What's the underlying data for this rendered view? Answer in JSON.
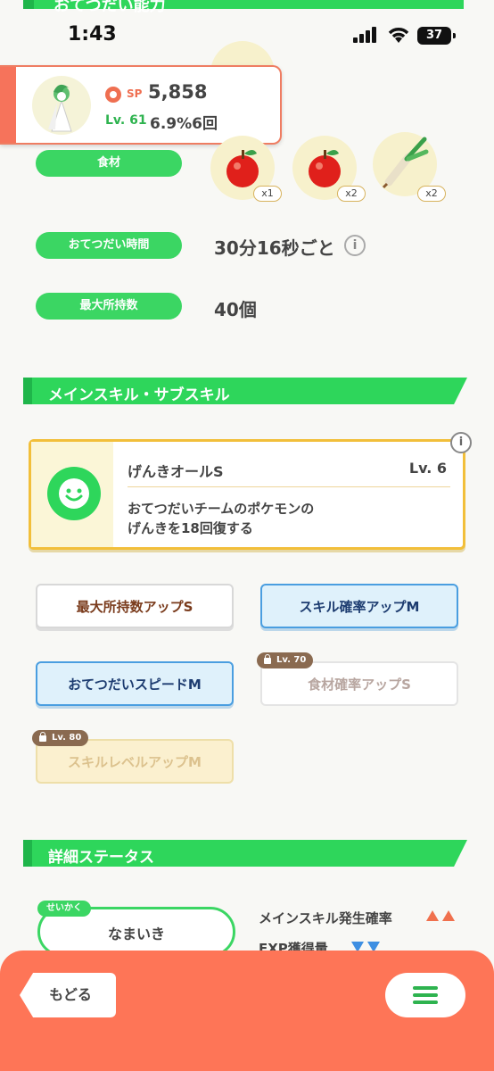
{
  "status_bar": {
    "time": "1:43",
    "battery": "37"
  },
  "top_banner": {
    "label": "おてつだい能力"
  },
  "pokemon": {
    "sp_label": "SP",
    "sp_value": "5,858",
    "level": "Lv. 61",
    "rate": "6.9%6回"
  },
  "helping": {
    "ingredients_label": "食材",
    "ingredients": [
      {
        "icon": "apple-icon",
        "count": "x1"
      },
      {
        "icon": "apple-icon",
        "count": "x2"
      },
      {
        "icon": "leek-icon",
        "count": "x2"
      }
    ],
    "time_label": "おてつだい時間",
    "time_value": "30分16秒ごと",
    "carry_label": "最大所持数",
    "carry_value": "40個"
  },
  "main_skill_section": {
    "header": "メインスキル・サブスキル",
    "skill": {
      "name": "げんきオールS",
      "level": "Lv. 6",
      "desc_line1": "おてつだいチームのポケモンの",
      "desc_line2": "げんきを18回復する"
    },
    "info": "i",
    "subskills": [
      {
        "label": "最大所持数アップS",
        "style": "normal"
      },
      {
        "label": "スキル確率アップM",
        "style": "blue"
      },
      {
        "label": "おてつだいスピードM",
        "style": "blue"
      },
      {
        "label": "食材確率アップS",
        "style": "locked",
        "lock": "Lv. 70"
      },
      {
        "label": "スキルレベルアップM",
        "style": "gold-locked",
        "lock": "Lv. 80"
      }
    ]
  },
  "details_section": {
    "header": "詳細ステータス",
    "nature_tag": "せいかく",
    "nature_value": "なまいき",
    "stats": [
      {
        "label": "メインスキル発生確率",
        "effect": "up"
      },
      {
        "label": "EXP獲得量",
        "effect": "down"
      }
    ]
  },
  "bottom_nav": {
    "back_label": "もどる"
  },
  "colors": {
    "accent_green": "#2ed65b",
    "bottom_bar": "#fe7557",
    "gold": "#f2bf3a"
  }
}
